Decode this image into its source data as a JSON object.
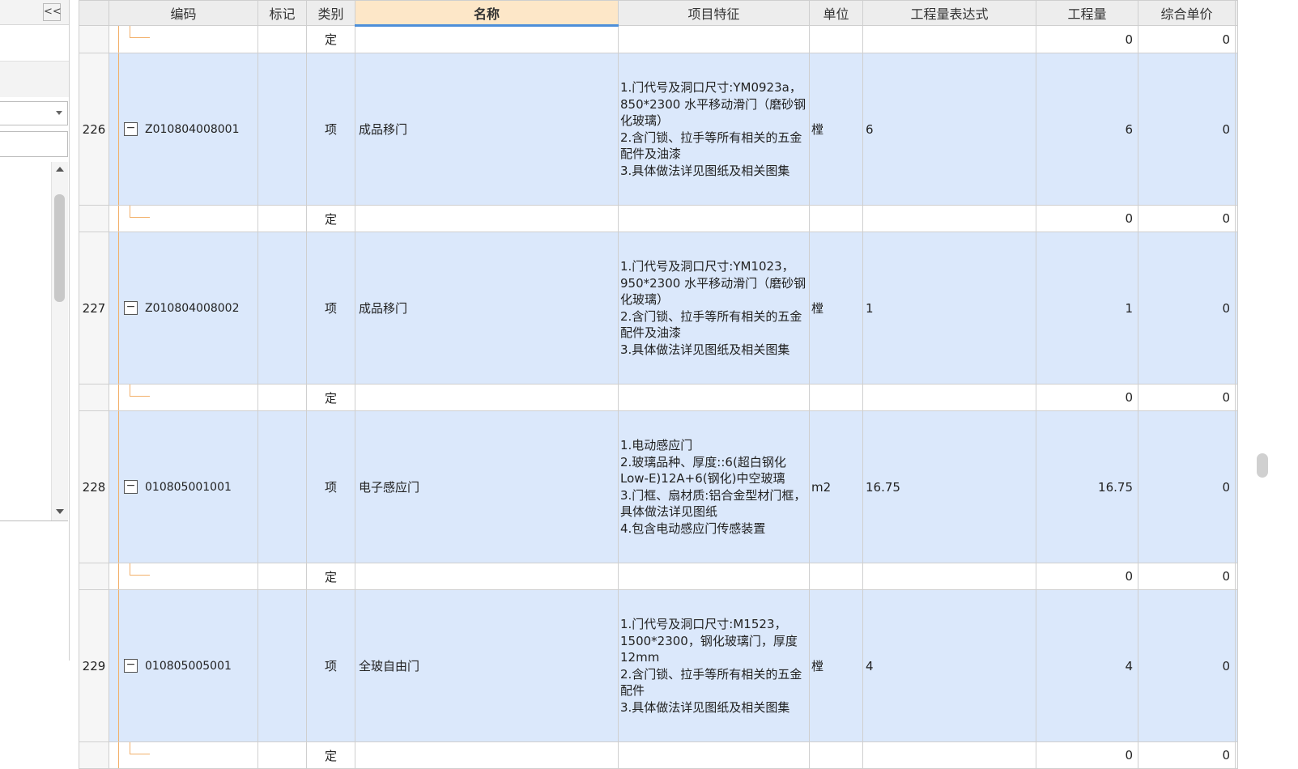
{
  "left_panel": {
    "collapse_label": "<<",
    "select_value": "",
    "search_value": ""
  },
  "columns": {
    "rownum": "",
    "code": "编码",
    "mark": "标记",
    "type": "类别",
    "name": "名称",
    "features": "项目特征",
    "unit": "单位",
    "expr": "工程量表达式",
    "qty": "工程量",
    "price": "综合单价"
  },
  "rows": [
    {
      "kind": "sub",
      "type": "定",
      "qty": "0",
      "price": "0"
    },
    {
      "kind": "item",
      "rownum": "226",
      "code": "Z010804008001",
      "type": "项",
      "name": "成品移门",
      "features": "1.门代号及洞口尺寸:YM0923a，850*2300 水平移动滑门（磨砂钢化玻璃）\n2.含门锁、拉手等所有相关的五金配件及油漆\n3.具体做法详见图纸及相关图集",
      "unit": "樘",
      "expr": "6",
      "qty": "6",
      "price": "0"
    },
    {
      "kind": "sub",
      "type": "定",
      "qty": "0",
      "price": "0"
    },
    {
      "kind": "item",
      "rownum": "227",
      "code": "Z010804008002",
      "type": "项",
      "name": "成品移门",
      "features": "1.门代号及洞口尺寸:YM1023，950*2300 水平移动滑门（磨砂钢化玻璃）\n2.含门锁、拉手等所有相关的五金配件及油漆\n3.具体做法详见图纸及相关图集",
      "unit": "樘",
      "expr": "1",
      "qty": "1",
      "price": "0"
    },
    {
      "kind": "sub",
      "type": "定",
      "qty": "0",
      "price": "0"
    },
    {
      "kind": "item",
      "rownum": "228",
      "code": "010805001001",
      "type": "项",
      "name": "电子感应门",
      "features": "1.电动感应门\n2.玻璃品种、厚度::6(超白钢化Low-E)12A+6(钢化)中空玻璃\n3.门框、扇材质:铝合金型材门框，具体做法详见图纸\n4.包含电动感应门传感装置",
      "unit": "m2",
      "expr": "16.75",
      "qty": "16.75",
      "price": "0"
    },
    {
      "kind": "sub",
      "type": "定",
      "qty": "0",
      "price": "0"
    },
    {
      "kind": "item",
      "rownum": "229",
      "code": "010805005001",
      "type": "项",
      "name": "全玻自由门",
      "features": "1.门代号及洞口尺寸:M1523，1500*2300，钢化玻璃门，厚度12mm\n2.含门锁、拉手等所有相关的五金配件\n3.具体做法详见图纸及相关图集",
      "unit": "樘",
      "expr": "4",
      "qty": "4",
      "price": "0"
    },
    {
      "kind": "sub",
      "type": "定",
      "qty": "0",
      "price": "0"
    }
  ],
  "colors": {
    "header_bg": "#ededed",
    "active_header_bg": "#fde7c8",
    "active_header_underline": "#4d8fd9",
    "item_row_bg": "#dbe8fb",
    "tree_line": "#f2b06a"
  },
  "icons": {
    "collapse": "double-chevron-left-icon",
    "expander": "minus-box-icon"
  }
}
